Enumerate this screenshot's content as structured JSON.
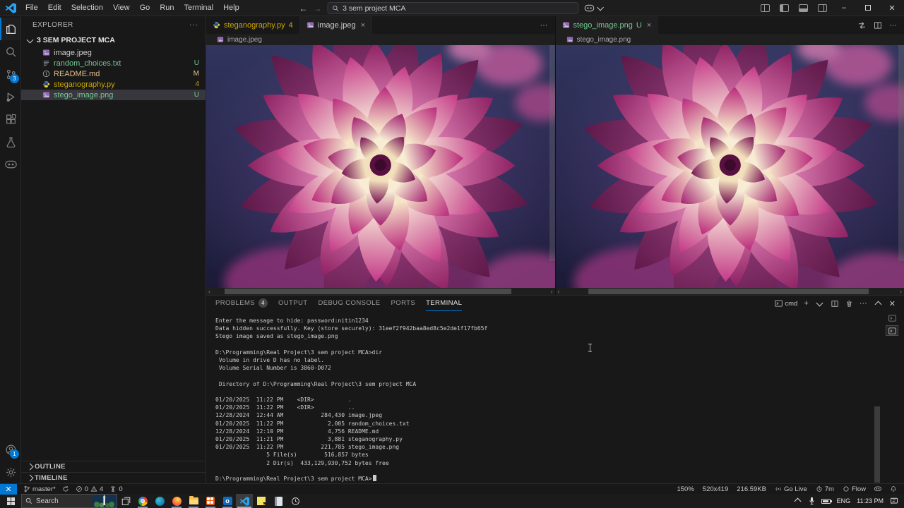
{
  "titlebar": {
    "menus": [
      "File",
      "Edit",
      "Selection",
      "View",
      "Go",
      "Run",
      "Terminal",
      "Help"
    ],
    "search_value": "3 sem project MCA",
    "nav_back": "←",
    "nav_forward": "→",
    "min_glyph": "–",
    "close_glyph": "✕"
  },
  "activity_bar": {
    "scm_badge": "3",
    "accounts_badge": "1"
  },
  "explorer": {
    "title": "EXPLORER",
    "more": "···",
    "project": "3 SEM PROJECT MCA",
    "files": [
      {
        "name": "image.jpeg",
        "badge": ""
      },
      {
        "name": "random_choices.txt",
        "badge": "U"
      },
      {
        "name": "README.md",
        "badge": "M"
      },
      {
        "name": "steganography.py",
        "badge": "4"
      },
      {
        "name": "stego_image.png",
        "badge": "U"
      }
    ],
    "outline": "OUTLINE",
    "timeline": "TIMELINE"
  },
  "editor_groups": {
    "left": {
      "tab_inactive": {
        "label": "steganography.py",
        "badge": "4"
      },
      "tab_active": {
        "label": "image.jpeg",
        "close": "×"
      },
      "breadcrumb": "image.jpeg",
      "more": "···"
    },
    "right": {
      "tab_active": {
        "label": "stego_image.png",
        "badge": "U",
        "close": "×"
      },
      "breadcrumb": "stego_image.png",
      "more": "···"
    }
  },
  "panel": {
    "tabs": [
      {
        "label": "PROBLEMS",
        "badge": "4"
      },
      {
        "label": "OUTPUT"
      },
      {
        "label": "DEBUG CONSOLE"
      },
      {
        "label": "PORTS"
      },
      {
        "label": "TERMINAL"
      }
    ],
    "shell_label": "cmd",
    "plus": "+",
    "more": "···",
    "close_glyph": "✕",
    "terminal_lines": [
      "Enter the message to hide: password:nitin1234",
      "Data hidden successfully. Key (store securely): 31eef2f942baa8ed8c5e2de1f17fb65f",
      "Stego image saved as stego_image.png",
      "",
      "D:\\Programming\\Real Project\\3 sem project MCA>dir",
      " Volume in drive D has no label.",
      " Volume Serial Number is 3860-D072",
      "",
      " Directory of D:\\Programming\\Real Project\\3 sem project MCA",
      "",
      "01/20/2025  11:22 PM    <DIR>          .",
      "01/20/2025  11:22 PM    <DIR>          ..",
      "12/28/2024  12:44 AM           284,430 image.jpeg",
      "01/20/2025  11:22 PM             2,005 random_choices.txt",
      "12/28/2024  12:10 PM             4,756 README.md",
      "01/20/2025  11:21 PM             3,881 steganography.py",
      "01/20/2025  11:22 PM           221,785 stego_image.png",
      "               5 File(s)        516,857 bytes",
      "               2 Dir(s)  433,129,930,752 bytes free",
      "",
      "D:\\Programming\\Real Project\\3 sem project MCA>"
    ]
  },
  "status_bar": {
    "branch": "master*",
    "errors": "0",
    "warnings": "4",
    "ports": "0",
    "zoom": "150%",
    "dimensions": "520x419",
    "file_size": "216.59KB",
    "go_live": "Go Live",
    "session_time": "7m",
    "flow": "Flow"
  },
  "taskbar": {
    "search_placeholder": "Search",
    "language": "ENG",
    "time": "11:23 PM"
  },
  "colors": {
    "accent": "#0078d4",
    "git_untracked": "#73c991",
    "git_modified": "#e2c08d",
    "warning": "#cca700",
    "flower_tip": "#c43a88",
    "flower_base": "#f6e6c9",
    "image_background": "#232447"
  }
}
